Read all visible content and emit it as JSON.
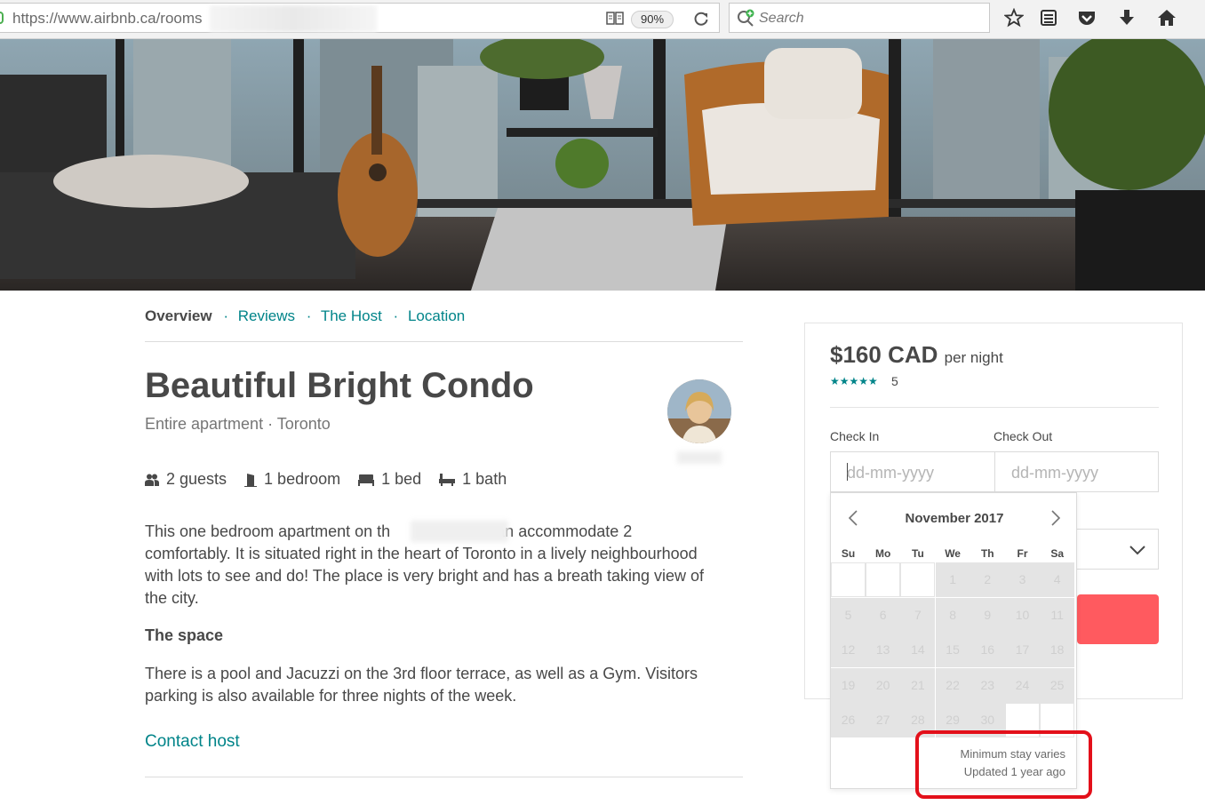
{
  "browser": {
    "url": "https://www.airbnb.ca/rooms",
    "zoom": "90%",
    "search_placeholder": "Search"
  },
  "nav": {
    "items": [
      {
        "label": "Overview",
        "active": true
      },
      {
        "label": "Reviews",
        "active": false
      },
      {
        "label": "The Host",
        "active": false
      },
      {
        "label": "Location",
        "active": false
      }
    ]
  },
  "listing": {
    "title": "Beautiful Bright Condo",
    "subtitle": "Entire apartment · Toronto",
    "amenities": {
      "guests": "2 guests",
      "bedroom": "1 bedroom",
      "bed": "1 bed",
      "bath": "1 bath"
    },
    "description_line1a": "This one bedroom apartment on th",
    "description_line1b": "can accommodate 2",
    "description_rest": "comfortably. It is situated right in the heart of Toronto in a lively neighbourhood with lots to see and do! The place is very bright and has a breath taking view of the city.",
    "space_heading": "The space",
    "space_text": "There is a pool and Jacuzzi on the 3rd floor terrace, as well as a Gym. Visitors parking is also available for three nights of the week.",
    "contact_link": "Contact host"
  },
  "booking": {
    "price": "$160 CAD",
    "per_night": "per night",
    "rating_stars": "★★★★★",
    "review_count": "5",
    "check_in_label": "Check In",
    "check_out_label": "Check Out",
    "check_in_placeholder": "dd-mm-yyyy",
    "check_out_placeholder": "dd-mm-yyyy"
  },
  "calendar": {
    "month": "November 2017",
    "days_of_week": [
      "Su",
      "Mo",
      "Tu",
      "We",
      "Th",
      "Fr",
      "Sa"
    ],
    "weeks": [
      [
        "",
        "",
        "",
        "1",
        "2",
        "3",
        "4"
      ],
      [
        "5",
        "6",
        "7",
        "8",
        "9",
        "10",
        "11"
      ],
      [
        "12",
        "13",
        "14",
        "15",
        "16",
        "17",
        "18"
      ],
      [
        "19",
        "20",
        "21",
        "22",
        "23",
        "24",
        "25"
      ],
      [
        "26",
        "27",
        "28",
        "29",
        "30",
        "",
        ""
      ]
    ],
    "footer_line1": "Minimum stay varies",
    "footer_line2": "Updated 1 year ago"
  },
  "colors": {
    "accent": "#008489",
    "brand": "#ff5a5f",
    "highlight": "#e3101a"
  }
}
